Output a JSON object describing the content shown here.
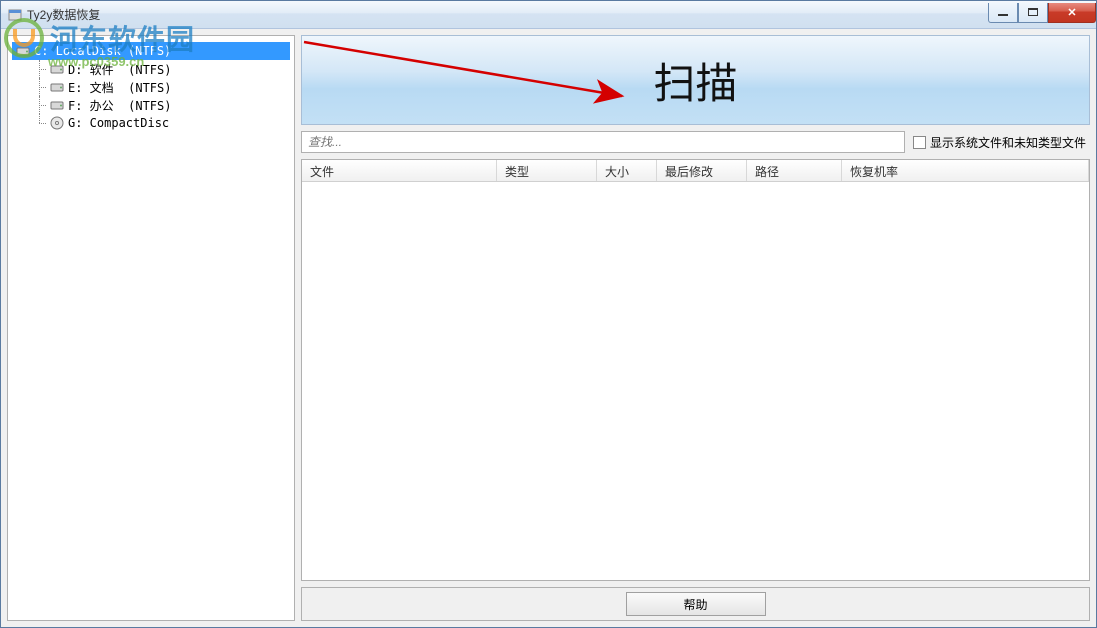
{
  "window": {
    "title": "Ty2y数据恢复"
  },
  "tree": {
    "items": [
      {
        "label": "C: LocalDisk (NTFS)",
        "selected": true
      },
      {
        "label": "D: 软件  (NTFS)",
        "selected": false
      },
      {
        "label": "E: 文档  (NTFS)",
        "selected": false
      },
      {
        "label": "F: 办公  (NTFS)",
        "selected": false
      },
      {
        "label": "G: CompactDisc",
        "selected": false
      }
    ]
  },
  "banner": {
    "scan_label": "扫描"
  },
  "search": {
    "placeholder": "查找..."
  },
  "checkbox": {
    "label": "显示系统文件和未知类型文件"
  },
  "columns": {
    "c1": "文件",
    "c2": "类型",
    "c3": "大小",
    "c4": "最后修改",
    "c5": "路径",
    "c6": "恢复机率"
  },
  "buttons": {
    "help": "帮助"
  },
  "watermark": {
    "main": "河东软件园",
    "sub": "www.pc0359.cn"
  }
}
